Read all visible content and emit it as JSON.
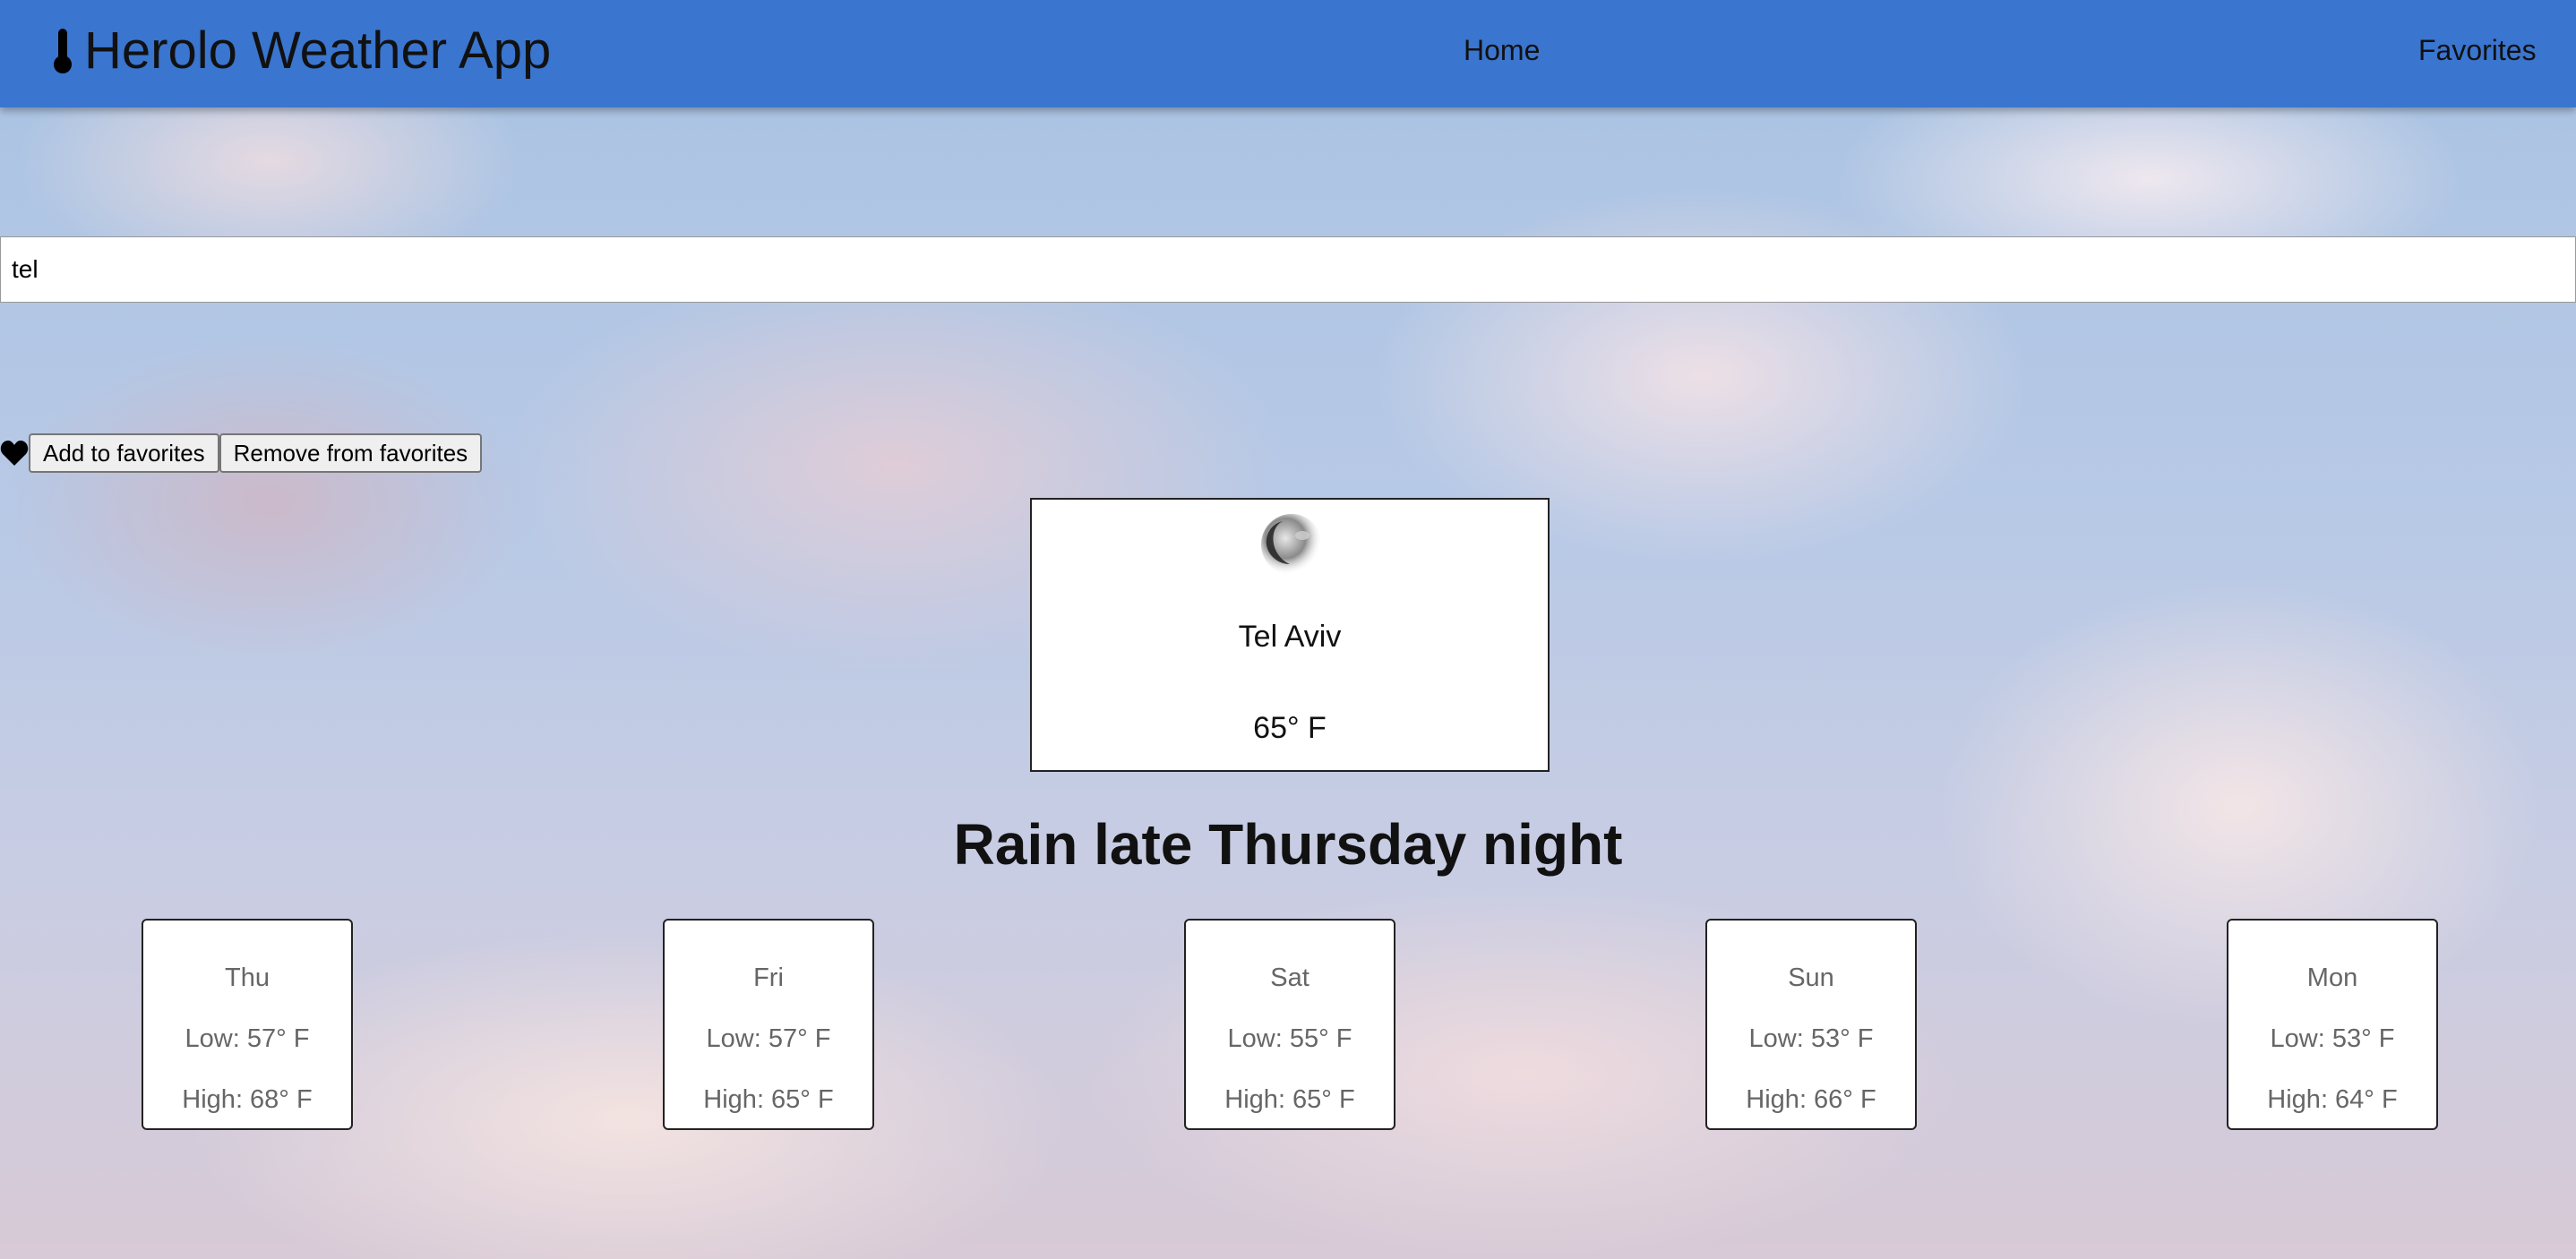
{
  "navbar": {
    "title": "Herolo Weather App",
    "home_label": "Home",
    "favorites_label": "Favorites",
    "color": "#3a75cf"
  },
  "search": {
    "value": "tel"
  },
  "favorites_actions": {
    "add_label": "Add to favorites",
    "remove_label": "Remove from favorites"
  },
  "current": {
    "icon": "night-moon-icon",
    "city": "Tel Aviv",
    "temperature": "65° F"
  },
  "headline": "Rain late Thursday night",
  "forecast": [
    {
      "day": "Thu",
      "low": "Low: 57° F",
      "high": "High: 68° F"
    },
    {
      "day": "Fri",
      "low": "Low: 57° F",
      "high": "High: 65° F"
    },
    {
      "day": "Sat",
      "low": "Low: 55° F",
      "high": "High: 65° F"
    },
    {
      "day": "Sun",
      "low": "Low: 53° F",
      "high": "High: 66° F"
    },
    {
      "day": "Mon",
      "low": "Low: 53° F",
      "high": "High: 64° F"
    }
  ]
}
